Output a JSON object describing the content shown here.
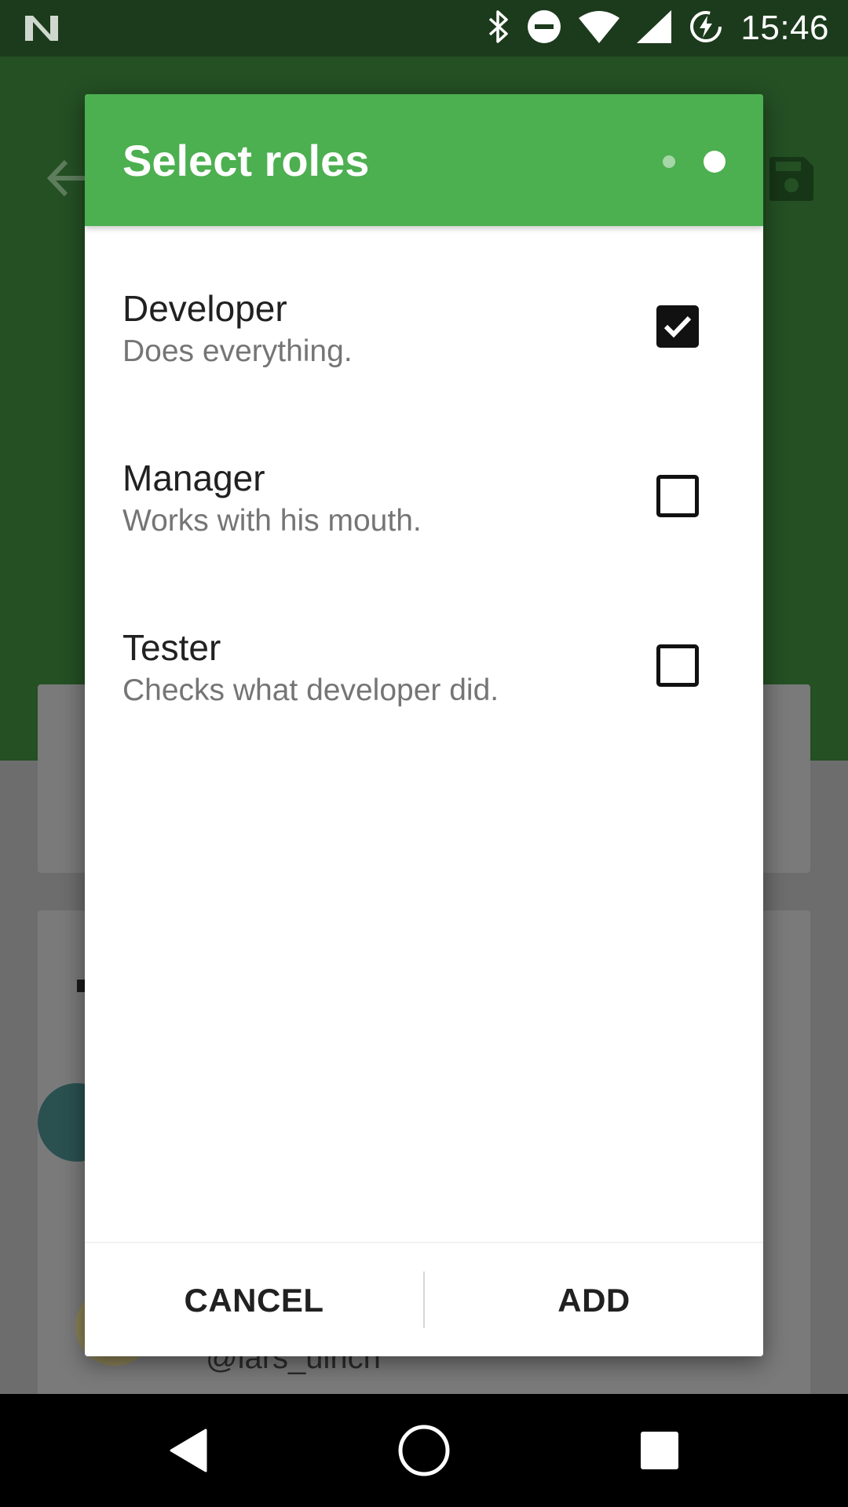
{
  "status_bar": {
    "time": "15:46",
    "icons": [
      "n-logo-icon",
      "bluetooth-icon",
      "do-not-disturb-icon",
      "wifi-icon",
      "cell-signal-icon",
      "battery-charging-icon"
    ]
  },
  "background": {
    "handle": "@lars_ulrich"
  },
  "dialog": {
    "title": "Select roles",
    "page_indicator": {
      "total": 2,
      "current": 2
    },
    "roles": [
      {
        "name": "Developer",
        "description": "Does everything.",
        "checked": true
      },
      {
        "name": "Manager",
        "description": "Works with his mouth.",
        "checked": false
      },
      {
        "name": "Tester",
        "description": "Checks what developer did.",
        "checked": false
      }
    ],
    "cancel_label": "CANCEL",
    "add_label": "ADD"
  },
  "colors": {
    "header": "#4caf50",
    "status_bar": "#1c3a1c",
    "scrim_green": "#245024"
  }
}
